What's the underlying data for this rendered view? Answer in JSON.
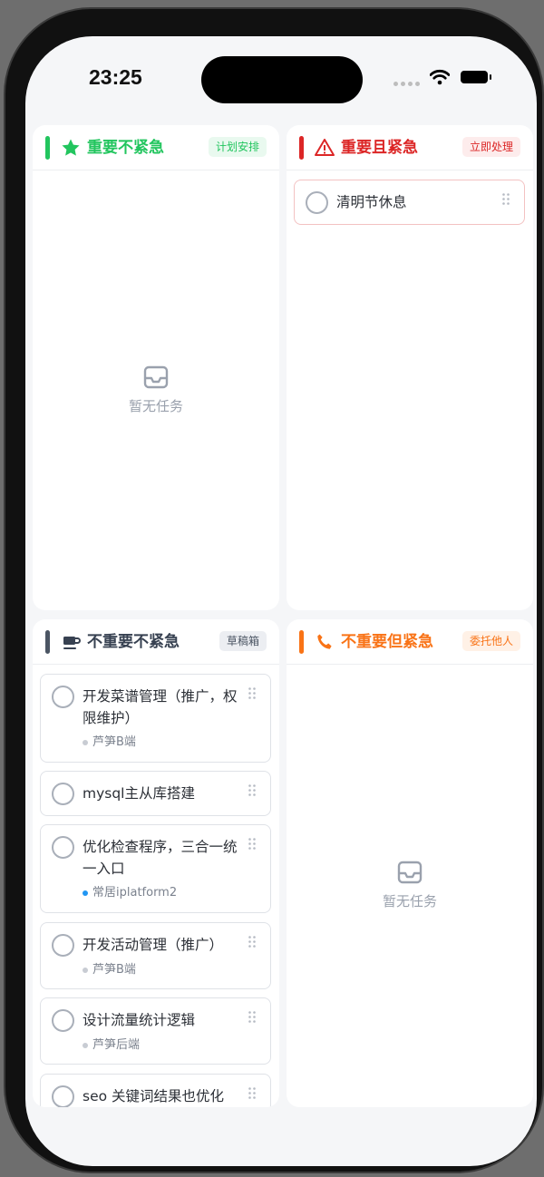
{
  "status": {
    "time": "23:25"
  },
  "colors": {
    "green": "#22c55e",
    "red": "#dc2626",
    "slate": "#4b5563",
    "orange": "#f97316",
    "blue": "#2196f3",
    "gray_dot": "#c8ccd3"
  },
  "quadrants": {
    "important_not_urgent": {
      "icon": "star-icon",
      "title": "重要不紧急",
      "badge": "计划安排",
      "empty_text": "暂无任务"
    },
    "important_urgent": {
      "icon": "warning-icon",
      "title": "重要且紧急",
      "badge": "立即处理",
      "tasks": [
        {
          "title": "清明节休息"
        }
      ]
    },
    "not_important_not_urgent": {
      "icon": "coffee-icon",
      "title": "不重要不紧急",
      "badge": "草稿箱",
      "tasks": [
        {
          "title": "开发菜谱管理（推广，权限维护）",
          "tag": "芦笋B端",
          "tag_color": "gray"
        },
        {
          "title": "mysql主从库搭建"
        },
        {
          "title": "优化检查程序，三合一统一入口",
          "tag": "常居iplatform2",
          "tag_color": "blue"
        },
        {
          "title": "开发活动管理（推广）",
          "tag": "芦笋B端",
          "tag_color": "gray"
        },
        {
          "title": "设计流量统计逻辑",
          "tag": "芦笋后端",
          "tag_color": "gray"
        },
        {
          "title": "seo 关键词结果也优化"
        }
      ]
    },
    "not_important_urgent": {
      "icon": "phone-icon",
      "title": "不重要但紧急",
      "badge": "委托他人",
      "empty_text": "暂无任务"
    }
  }
}
